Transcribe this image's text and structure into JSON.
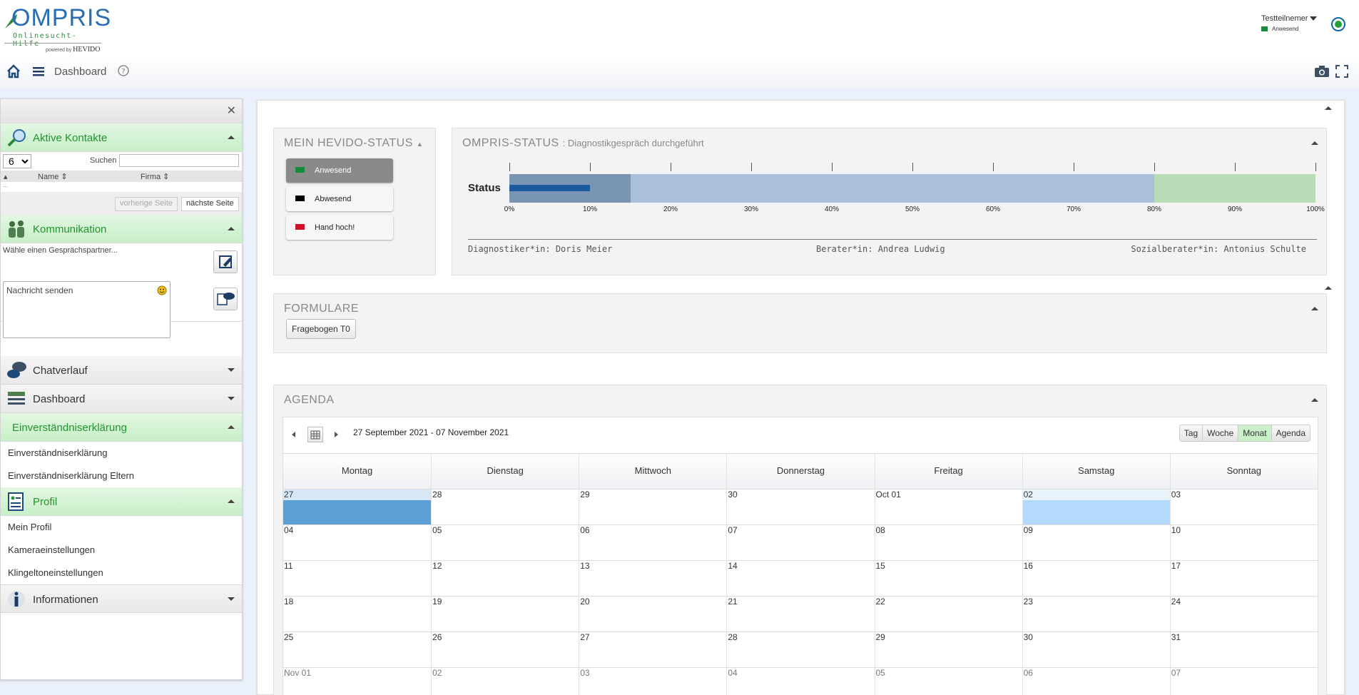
{
  "header": {
    "logo_text": "OMPRIS",
    "logo_sub": "Onlinesucht-Hilfe",
    "logo_powered": "powered by",
    "logo_hevido": "HEVIDO",
    "user_name": "Testteilnemer",
    "user_status": "Anwesend",
    "status_color": "#1a8a3c"
  },
  "toolbar": {
    "dashboard_label": "Dashboard"
  },
  "sidebar": {
    "contacts": {
      "title": "Aktive Kontakte",
      "page_size": "6",
      "search_label": "Suchen",
      "col_name": "Name",
      "col_firma": "Firma",
      "empty": "...",
      "prev": "vorherige Seite",
      "next": "nächste Seite"
    },
    "kommunikation": {
      "title": "Kommunikation",
      "hint": "Wähle einen Gesprächspartner...",
      "message_placeholder": "Nachricht senden"
    },
    "chatverlauf": "Chatverlauf",
    "dashboard": "Dashboard",
    "einverstaendnis": {
      "title": "Einverständniserklärung",
      "items": [
        "Einverständniserklärung",
        "Einverständniserklärung Eltern"
      ]
    },
    "profil": {
      "title": "Profil",
      "items": [
        "Mein Profil",
        "Kameraeinstellungen",
        "Klingeltoneinstellungen"
      ]
    },
    "informationen": "Informationen"
  },
  "hevido_status": {
    "title": "MEIN HEVIDO-STATUS",
    "buttons": [
      {
        "label": "Anwesend",
        "color": "#1a8a3c"
      },
      {
        "label": "Abwesend",
        "color": "#000000"
      },
      {
        "label": "Hand hoch!",
        "color": "#d0102a"
      }
    ]
  },
  "ompris_status": {
    "title": "OMPRIS-STATUS",
    "subtitle": ": Diagnostikgespräch durchgeführt",
    "bar_label": "Status",
    "progress_fraction": 0.1,
    "segments": [
      {
        "from": 0,
        "to": 15,
        "color": "#7a94b4"
      },
      {
        "from": 15,
        "to": 80,
        "color": "#a9bfda"
      },
      {
        "from": 80,
        "to": 100,
        "color": "#b8dbb8"
      }
    ],
    "progress_color": "#1c5a9e",
    "ticks": [
      "0%",
      "10%",
      "20%",
      "30%",
      "40%",
      "50%",
      "60%",
      "70%",
      "80%",
      "90%",
      "100%"
    ],
    "roles": [
      "Diagnostiker*in: Doris Meier",
      "Berater*in: Andrea Ludwig",
      "Sozialberater*in: Antonius Schulte"
    ]
  },
  "formulare": {
    "title": "FORMULARE",
    "button": "Fragebogen T0"
  },
  "agenda": {
    "title": "AGENDA",
    "range": "27 September 2021 - 07 November 2021",
    "views": [
      "Tag",
      "Woche",
      "Monat",
      "Agenda"
    ],
    "active_view": "Monat",
    "days": [
      "Montag",
      "Dienstag",
      "Mittwoch",
      "Donnerstag",
      "Freitag",
      "Samstag",
      "Sonntag"
    ],
    "weeks": [
      [
        "27",
        "28",
        "29",
        "30",
        "Oct 01",
        "02",
        "03"
      ],
      [
        "04",
        "05",
        "06",
        "07",
        "08",
        "09",
        "10"
      ],
      [
        "11",
        "12",
        "13",
        "14",
        "15",
        "16",
        "17"
      ],
      [
        "18",
        "19",
        "20",
        "21",
        "22",
        "23",
        "24"
      ],
      [
        "25",
        "26",
        "27",
        "28",
        "29",
        "30",
        "31"
      ],
      [
        "Nov 01",
        "02",
        "03",
        "04",
        "05",
        "06",
        "07"
      ]
    ]
  }
}
